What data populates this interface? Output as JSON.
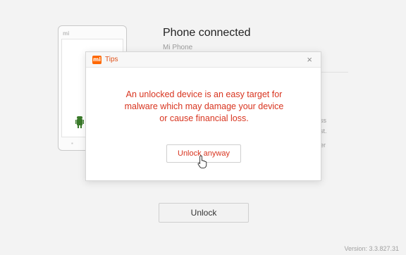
{
  "background": {
    "phone_logo": "mi",
    "title": "Phone connected",
    "subtitle": "Mi Phone",
    "snippets": [
      "ss",
      "st.",
      "er"
    ],
    "unlock_button_label": "Unlock",
    "version_text": "Version: 3.3.827.31"
  },
  "dialog": {
    "logo_text": "mi",
    "title": "Tips",
    "close_glyph": "×",
    "warning_lines": [
      "An unlocked device is an easy target for",
      "malware which may damage your device",
      "or cause financial loss."
    ],
    "unlock_anyway_label": "Unlock anyway"
  },
  "colors": {
    "accent_orange": "#ff6700",
    "warning_red": "#d8341f"
  },
  "icons": {
    "close": "close-icon",
    "cursor": "hand-cursor-icon",
    "robot": "android-robot-icon"
  }
}
